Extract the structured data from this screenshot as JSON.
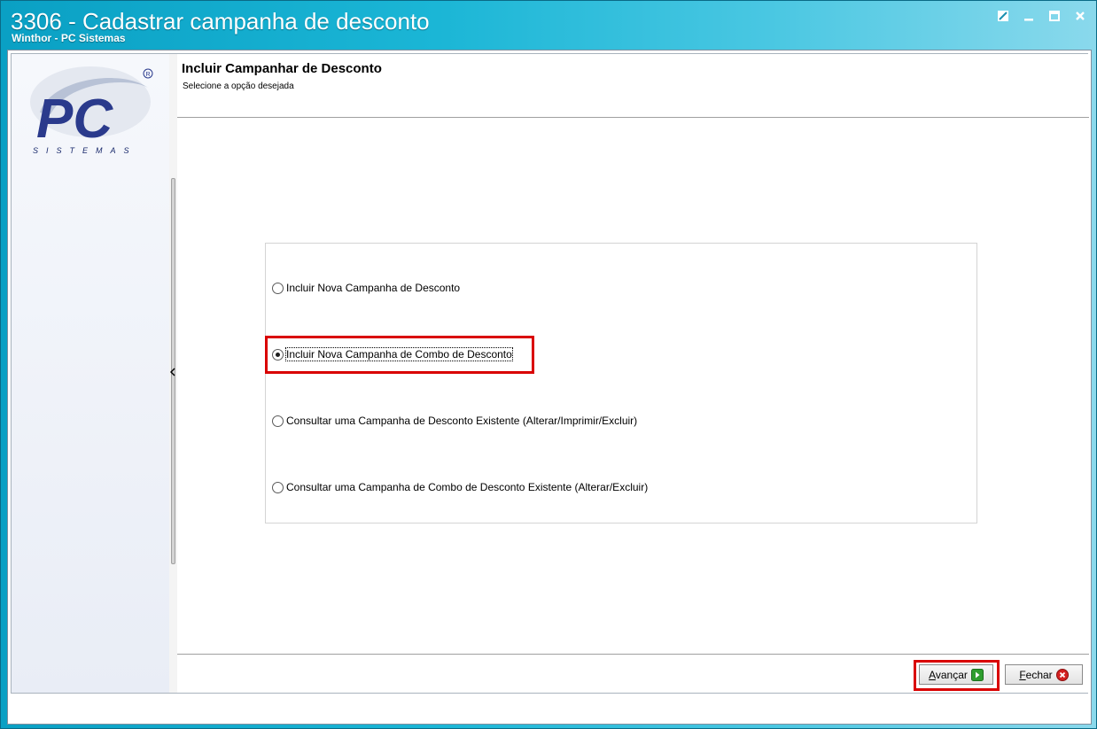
{
  "window": {
    "title": "3306 - Cadastrar campanha de desconto",
    "subtitle": "Winthor - PC Sistemas",
    "controls": [
      "restore-icon",
      "minimize-icon",
      "maximize-icon",
      "close-icon"
    ]
  },
  "sidebar": {
    "logo_text": "PC",
    "logo_subtext": "SISTEMAS",
    "logo_mark": "®"
  },
  "header": {
    "title": "Incluir Campanhar de Desconto",
    "subtitle": "Selecione a opção desejada"
  },
  "options": [
    {
      "label": "Incluir Nova Campanha de Desconto",
      "checked": false
    },
    {
      "label": "Incluir Nova Campanha de Combo de Desconto",
      "checked": true
    },
    {
      "label": "Consultar uma Campanha de Desconto Existente (Alterar/Imprimir/Excluir)",
      "checked": false
    },
    {
      "label": "Consultar uma Campanha de Combo de Desconto Existente (Alterar/Excluir)",
      "checked": false
    }
  ],
  "footer": {
    "next_accel": "A",
    "next_rest": "vançar",
    "close_accel": "F",
    "close_rest": "echar"
  },
  "colors": {
    "title_bar": "#1bb6d6",
    "highlight": "#d90000",
    "next_icon": "#2e9e2e",
    "close_icon": "#d42020"
  }
}
